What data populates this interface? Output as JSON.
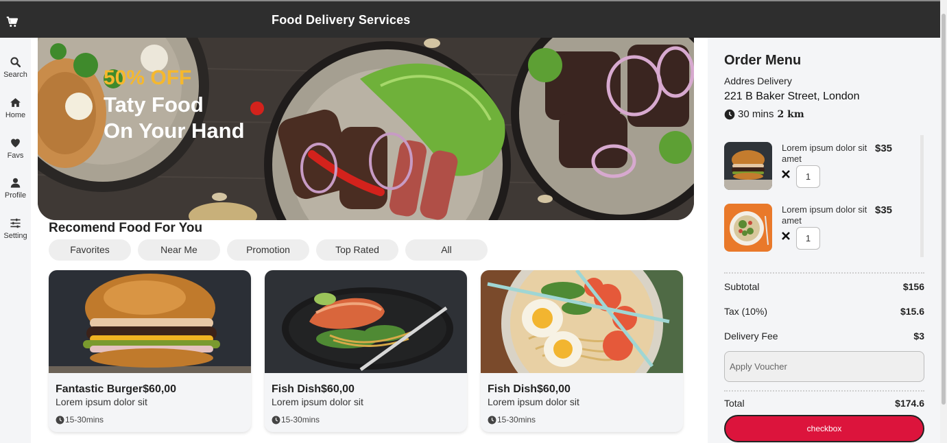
{
  "header": {
    "title": "Food Delivery Services",
    "cart_icon": "cart-icon"
  },
  "sidebar": {
    "items": [
      {
        "label": "Search",
        "icon": "search-icon"
      },
      {
        "label": "Home",
        "icon": "home-icon"
      },
      {
        "label": "Favs",
        "icon": "heart-icon"
      },
      {
        "label": "Profile",
        "icon": "user-icon"
      },
      {
        "label": "Setting",
        "icon": "sliders-icon"
      }
    ]
  },
  "hero": {
    "discount": "50% OFF",
    "line1": "Taty Food",
    "line2": "On Your Hand"
  },
  "recommend": {
    "title": "Recomend Food For You",
    "filters": [
      "Favorites",
      "Near Me",
      "Promotion",
      "Top Rated",
      "All"
    ]
  },
  "foods": [
    {
      "name": "Fantastic Burger",
      "price": "$60,00",
      "desc": "Lorem ipsum dolor sit",
      "time": "15-30mins"
    },
    {
      "name": "Fish Dish",
      "price": "$60,00",
      "desc": "Lorem ipsum dolor sit",
      "time": "15-30mins"
    },
    {
      "name": "Fish Dish",
      "price": "$60,00",
      "desc": "Lorem ipsum dolor sit",
      "time": "15-30mins"
    }
  ],
  "order": {
    "title": "Order Menu",
    "address_label": "Addres Delivery",
    "address": "221 B Baker Street, London",
    "eta": "30 mins",
    "distance": "2 km",
    "items": [
      {
        "name": "Lorem ipsum dolor sit amet",
        "price": "$35",
        "qty": "1"
      },
      {
        "name": "Lorem ipsum dolor sit amet",
        "price": "$35",
        "qty": "1"
      }
    ],
    "subtotal_label": "Subtotal",
    "subtotal": "$156",
    "tax_label": "Tax (10%)",
    "tax": "$15.6",
    "delivery_label": "Delivery Fee",
    "delivery": "$3",
    "voucher_placeholder": "Apply Voucher",
    "total_label": "Total",
    "total": "$174.6",
    "checkout_label": "checkbox"
  },
  "colors": {
    "topbar": "#2e2e2e",
    "accent": "#dc143c",
    "discount": "#f5b82e",
    "panel": "#f4f5f7"
  }
}
